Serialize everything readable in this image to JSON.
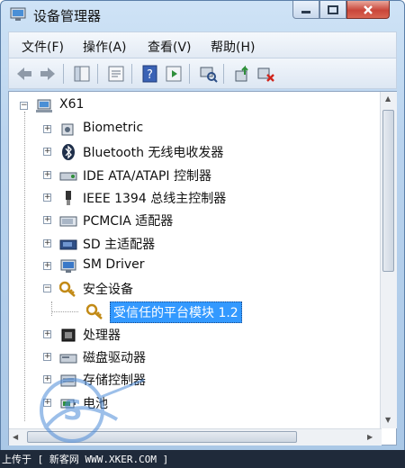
{
  "window": {
    "title": "设备管理器"
  },
  "menu": [
    "文件(F)",
    "操作(A)",
    "查看(V)",
    "帮助(H)"
  ],
  "toolbar_icons": [
    "back-arrow-icon",
    "forward-arrow-icon",
    "show-hide-tree-icon",
    "properties-icon",
    "help-icon",
    "run-icon",
    "scan-hardware-icon",
    "update-driver-icon",
    "uninstall-icon"
  ],
  "tree": {
    "root": "X61",
    "items": [
      {
        "label": "Biometric",
        "icon": "biometric-device-icon",
        "expander": "+"
      },
      {
        "label": "Bluetooth 无线电收发器",
        "icon": "bluetooth-icon",
        "expander": "+"
      },
      {
        "label": "IDE ATA/ATAPI 控制器",
        "icon": "ide-controller-icon",
        "expander": "+"
      },
      {
        "label": "IEEE 1394 总线主控制器",
        "icon": "ieee1394-icon",
        "expander": "+"
      },
      {
        "label": "PCMCIA 适配器",
        "icon": "pcmcia-icon",
        "expander": "+"
      },
      {
        "label": "SD 主适配器",
        "icon": "sd-card-icon",
        "expander": "+"
      },
      {
        "label": "SM Driver",
        "icon": "monitor-icon",
        "expander": "+"
      },
      {
        "label": "安全设备",
        "icon": "security-key-icon",
        "expander": "−"
      },
      {
        "label": "受信任的平台模块 1.2",
        "icon": "security-key-icon",
        "selected": true,
        "child": true
      },
      {
        "label": "处理器",
        "icon": "processor-icon",
        "expander": "+"
      },
      {
        "label": "磁盘驱动器",
        "icon": "disk-drive-icon",
        "expander": "+"
      },
      {
        "label": "存储控制器",
        "icon": "storage-controller-icon",
        "expander": "+"
      },
      {
        "label": "电池",
        "icon": "battery-icon",
        "expander": "+"
      }
    ]
  },
  "watermark": {
    "text": "上传于 [ 新客网 WWW.XKER.COM ]"
  },
  "colors": {
    "selection": "#3399ff",
    "title_gradient": "#b9d3ee",
    "close": "#c9463a"
  }
}
